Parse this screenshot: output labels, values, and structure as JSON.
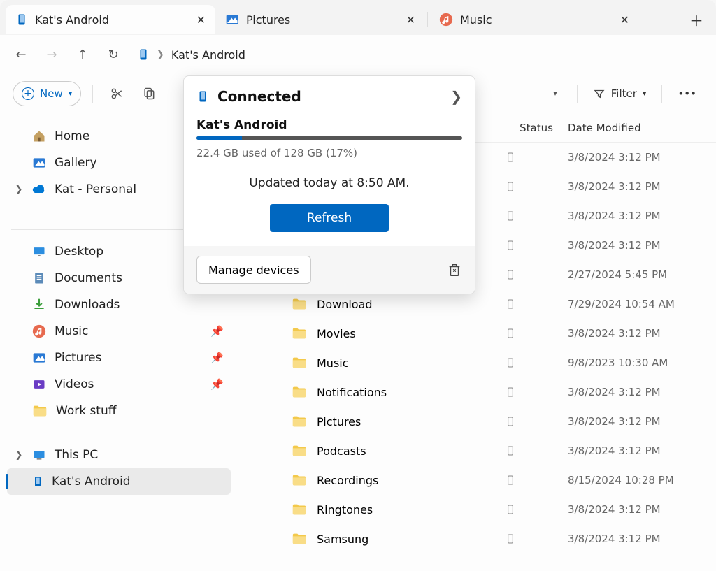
{
  "tabs": [
    {
      "label": "Kat's Android",
      "icon": "phone"
    },
    {
      "label": "Pictures",
      "icon": "pictures"
    },
    {
      "label": "Music",
      "icon": "music"
    }
  ],
  "address": {
    "label": "Kat's Android"
  },
  "toolbar": {
    "new_label": "New",
    "filter_label": "Filter"
  },
  "sidebar": {
    "home": "Home",
    "gallery": "Gallery",
    "kat_personal": "Kat - Personal",
    "desktop": "Desktop",
    "documents": "Documents",
    "downloads": "Downloads",
    "music": "Music",
    "pictures": "Pictures",
    "videos": "Videos",
    "work_stuff": "Work stuff",
    "this_pc": "This PC",
    "kats_android": "Kat's Android"
  },
  "columns": {
    "status": "Status",
    "date": "Date Modified"
  },
  "files": [
    {
      "name": "",
      "date": "3/8/2024 3:12 PM"
    },
    {
      "name": "",
      "date": "3/8/2024 3:12 PM"
    },
    {
      "name": "",
      "date": "3/8/2024 3:12 PM"
    },
    {
      "name": "",
      "date": "3/8/2024 3:12 PM"
    },
    {
      "name": "",
      "date": "2/27/2024 5:45 PM"
    },
    {
      "name": "Download",
      "date": "7/29/2024 10:54 AM"
    },
    {
      "name": "Movies",
      "date": "3/8/2024 3:12 PM"
    },
    {
      "name": "Music",
      "date": "9/8/2023 10:30 AM"
    },
    {
      "name": "Notifications",
      "date": "3/8/2024 3:12 PM"
    },
    {
      "name": "Pictures",
      "date": "3/8/2024 3:12 PM"
    },
    {
      "name": "Podcasts",
      "date": "3/8/2024 3:12 PM"
    },
    {
      "name": "Recordings",
      "date": "8/15/2024 10:28 PM"
    },
    {
      "name": "Ringtones",
      "date": "3/8/2024 3:12 PM"
    },
    {
      "name": "Samsung",
      "date": "3/8/2024 3:12 PM"
    }
  ],
  "popup": {
    "connected": "Connected",
    "device_name": "Kat's Android",
    "storage_text": "22.4 GB used of 128 GB (17%)",
    "storage_percent": 17,
    "updated_text": "Updated today at 8:50 AM.",
    "refresh_label": "Refresh",
    "manage_label": "Manage devices"
  }
}
